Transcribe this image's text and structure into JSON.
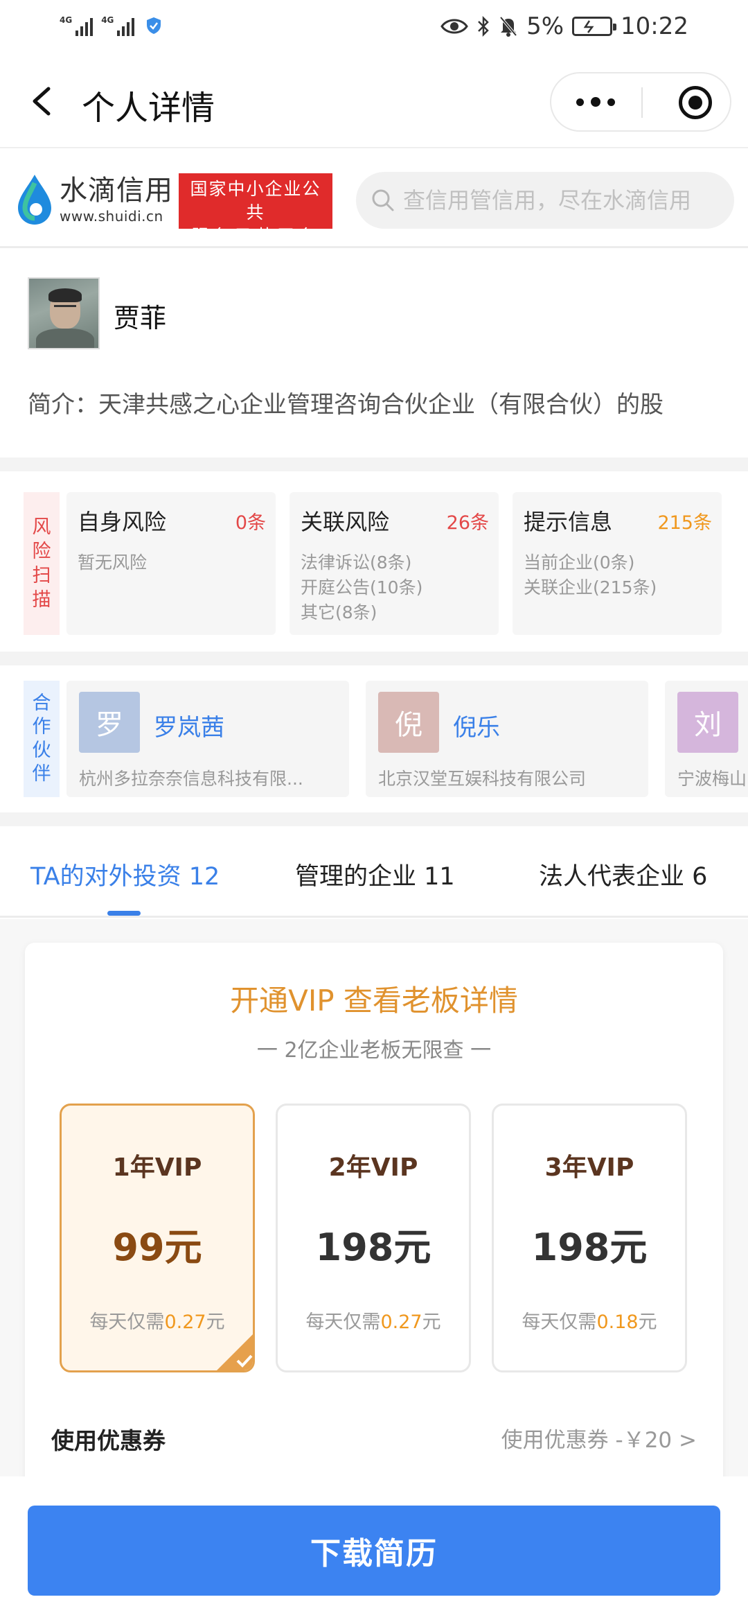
{
  "status_bar": {
    "signal1_label": "4G",
    "signal2_label": "4G",
    "battery": "5%",
    "time": "10:22"
  },
  "nav": {
    "title": "个人详情"
  },
  "brand": {
    "logo_name": "水滴信用",
    "logo_url": "www.shuidi.cn",
    "badge_line1": "国家中小企业公共",
    "badge_line2": "服务示范平台",
    "search_placeholder": "查信用管信用，尽在水滴信用"
  },
  "profile": {
    "name": "贾菲",
    "intro": "简介：天津共感之心企业管理咨询合伙企业（有限合伙）的股"
  },
  "risk": {
    "side_label": [
      "风",
      "险",
      "扫",
      "描"
    ],
    "cards": [
      {
        "title": "自身风险",
        "count": "0条",
        "lines": [
          "暂无风险"
        ]
      },
      {
        "title": "关联风险",
        "count": "26条",
        "lines": [
          "法律诉讼(8条)",
          "开庭公告(10条)",
          "其它(8条)"
        ]
      },
      {
        "title": "提示信息",
        "count": "215条",
        "lines": [
          "当前企业(0条)",
          "关联企业(215条)"
        ]
      }
    ]
  },
  "partners": {
    "side_label": [
      "合",
      "作",
      "伙",
      "伴"
    ],
    "items": [
      {
        "avatar_char": "罗",
        "name": "罗岚茜",
        "company": "杭州多拉奈奈信息科技有限...",
        "color": "#b5c6e2"
      },
      {
        "avatar_char": "倪",
        "name": "倪乐",
        "company": "北京汉堂互娱科技有限公司",
        "color": "#d9b9b5"
      },
      {
        "avatar_char": "刘",
        "name": "",
        "company": "宁波梅山",
        "color": "#d5b6dc"
      }
    ]
  },
  "tabs": [
    {
      "label": "TA的对外投资 12",
      "active": true
    },
    {
      "label": "管理的企业 11",
      "active": false
    },
    {
      "label": "法人代表企业 6",
      "active": false
    }
  ],
  "vip": {
    "title": "开通VIP 查看老板详情",
    "subtitle": "一 2亿企业老板无限查 一",
    "plans": [
      {
        "name": "1年VIP",
        "price": "99元",
        "daily_prefix": "每天仅需",
        "daily_amount": "0.27",
        "daily_suffix": "元",
        "selected": true
      },
      {
        "name": "2年VIP",
        "price": "198元",
        "daily_prefix": "每天仅需",
        "daily_amount": "0.27",
        "daily_suffix": "元",
        "selected": false
      },
      {
        "name": "3年VIP",
        "price": "198元",
        "daily_prefix": "每天仅需",
        "daily_amount": "0.18",
        "daily_suffix": "元",
        "selected": false
      }
    ],
    "coupon_label": "使用优惠券",
    "coupon_value": "使用优惠券 -￥20 >"
  },
  "bottom": {
    "button_label": "下载简历"
  },
  "colors": {
    "primary_blue": "#3c83f1",
    "risk_red": "#e34848",
    "vip_orange": "#e0922e",
    "count_orange": "#f0981e"
  }
}
